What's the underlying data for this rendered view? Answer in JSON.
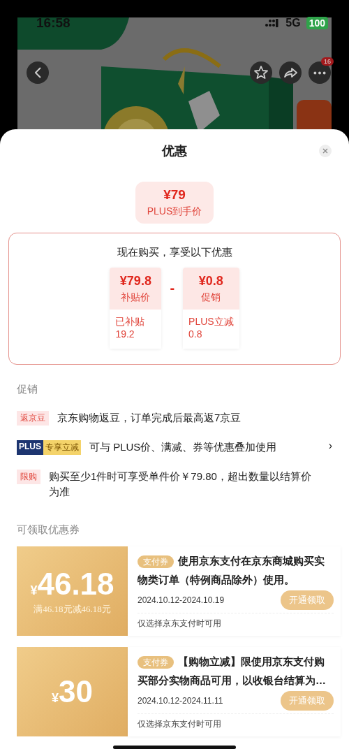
{
  "status_bar": {
    "time": "16:58",
    "network": "5G",
    "battery": "100"
  },
  "product_header": {
    "more_badge": "16"
  },
  "sheet": {
    "title": "优惠",
    "price_summary": {
      "price": "¥79",
      "label": "PLUS到手价"
    },
    "breakdown": {
      "heading": "现在购买，享受以下优惠",
      "operator": "-",
      "items": [
        {
          "price": "¥79.8",
          "label": "补贴价",
          "detail": "已补贴",
          "detail_value": "19.2"
        },
        {
          "price": "¥0.8",
          "label": "促销",
          "detail": "PLUS立减",
          "detail_value": "0.8"
        }
      ]
    },
    "promotions": {
      "heading": "促销",
      "items": [
        {
          "kind": "tag",
          "tag": "返京豆",
          "text": "京东购物返豆，订单完成后最高返7京豆"
        },
        {
          "kind": "plus",
          "tag": "PLUS",
          "tag_extra": "专享立减",
          "text": "可与 PLUS价、满减、券等优惠叠加使用",
          "arrow": "›"
        },
        {
          "kind": "tag",
          "tag": "限购",
          "text": "购买至少1件时可享受单件价￥79.80，超出数量以结算价为准"
        }
      ]
    },
    "coupons": {
      "heading": "可领取优惠券",
      "items": [
        {
          "currency": "¥",
          "amount": "46.18",
          "condition": "满46.18元减46.18元",
          "tag": "支付券",
          "description": "使用京东支付在京东商城购买实物类订单（特例商品除外）使用。",
          "date": "2024.10.12-2024.10.19",
          "button": "开通领取",
          "note": "仅选择京东支付时可用"
        },
        {
          "currency": "¥",
          "amount": "30",
          "tag": "支付券",
          "description": "【购物立减】限使用京东支付购买部分实物商品可用，以收银台结算为…",
          "date": "2024.10.12-2024.11.11",
          "button": "开通领取",
          "note": "仅选择京东支付时可用"
        }
      ]
    }
  }
}
